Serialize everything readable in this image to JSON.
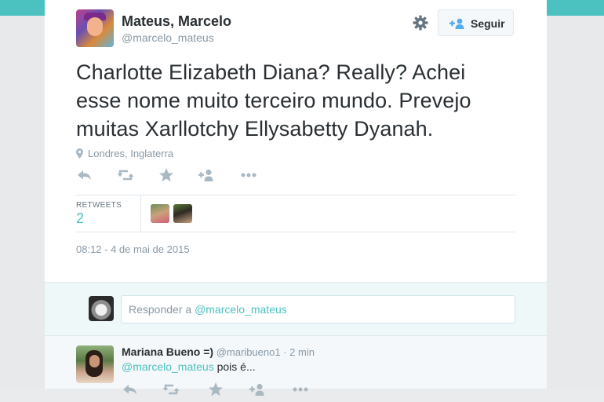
{
  "tweet": {
    "author_name": "Mateus, Marcelo",
    "author_handle": "@marcelo_mateus",
    "follow_label": "Seguir",
    "text": "Charlotte Elizabeth Diana? Really? Achei esse nome muito terceiro mundo. Prevejo muitas Xarllotchy Ellysabetty Dyanah.",
    "location": "Londres, Inglaterra",
    "actions": [
      "reply-icon",
      "retweet-icon",
      "favorite-icon",
      "follow-icon",
      "more-icon"
    ],
    "stats": {
      "retweets_label": "RETWEETS",
      "retweets_count": "2"
    },
    "timestamp": "08:12 - 4 de mai de 2015"
  },
  "reply_box": {
    "prefix": "Responder a ",
    "mention": "@marcelo_mateus"
  },
  "reply": {
    "name": "Mariana Bueno =)",
    "handle": "@maribueno1",
    "separator": "·",
    "time": "2 min",
    "mention": "@marcelo_mateus",
    "text": " pois é..."
  },
  "colors": {
    "accent": "#4cc2c0",
    "muted": "#8899a6",
    "text": "#292f33"
  }
}
